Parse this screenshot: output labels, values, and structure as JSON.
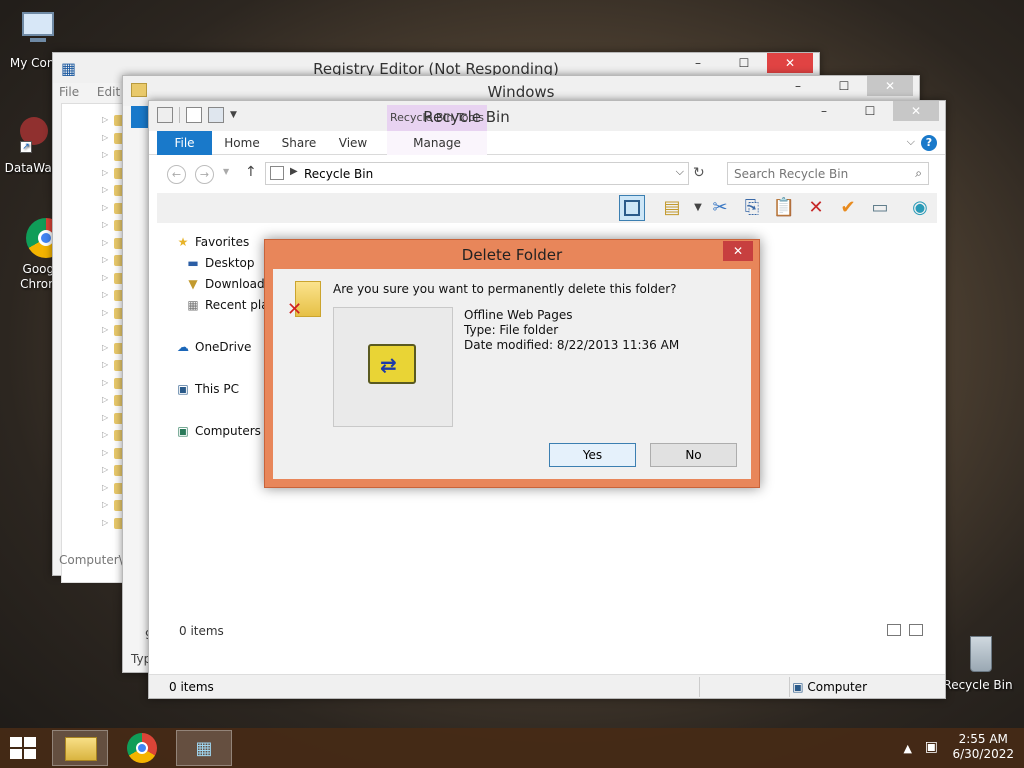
{
  "desktop": {
    "icons": [
      {
        "label": "My Comp"
      },
      {
        "label": "DataWag"
      },
      {
        "label": "Googl Chrom"
      },
      {
        "label": "Recycle Bin"
      }
    ]
  },
  "registry_editor": {
    "title": "Registry Editor (Not Responding)",
    "menu_file": "File",
    "menu_edit": "Edit",
    "status": "Computer\\"
  },
  "windows_folder": {
    "title": "Windows",
    "status_partial": "Typ",
    "number_partial": "9"
  },
  "recycle_bin": {
    "title": "Recycle Bin",
    "tools_tab": "Recycle Bin Tools",
    "tabs": {
      "file": "File",
      "home": "Home",
      "share": "Share",
      "view": "View",
      "manage": "Manage"
    },
    "address": "Recycle Bin",
    "search_placeholder": "Search Recycle Bin",
    "nav": {
      "favorites": "Favorites",
      "desktop": "Desktop",
      "downloads": "Downloads",
      "recent": "Recent plac",
      "onedrive": "OneDrive",
      "thispc": "This PC",
      "computers": "Computers a"
    },
    "items_inner": "0 items",
    "status_items": "0 items",
    "status_computer": "Computer"
  },
  "dialog": {
    "title": "Delete Folder",
    "question": "Are you sure you want to permanently delete this folder?",
    "name": "Offline Web Pages",
    "type": "Type: File folder",
    "modified": "Date modified: 8/22/2013 11:36 AM",
    "yes": "Yes",
    "no": "No"
  },
  "taskbar": {
    "time": "2:55 AM",
    "date": "6/30/2022"
  },
  "colors": {
    "accent_blue": "#1979ca",
    "dialog_border": "#e8865a",
    "close_red": "#e04343",
    "tools_purple": "#e8d3f1"
  }
}
